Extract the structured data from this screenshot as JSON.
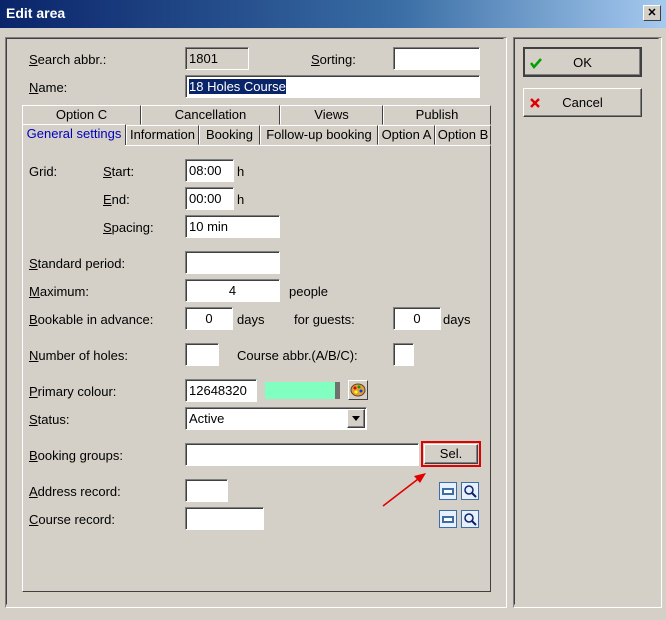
{
  "window": {
    "title": "Edit area"
  },
  "form": {
    "search_abbr_label": "Search abbr.:",
    "search_abbr_value": "1801",
    "sorting_label": "Sorting:",
    "sorting_value": "",
    "name_label": "Name:",
    "name_value": "18 Holes Course"
  },
  "tabs_row1": [
    "Option C",
    "Cancellation",
    "Views",
    "Publish"
  ],
  "tabs_row2": [
    "General settings",
    "Information",
    "Booking",
    "Follow-up booking",
    "Option A",
    "Option B"
  ],
  "general": {
    "grid_label": "Grid:",
    "start_label": "Start:",
    "start_value": "08:00",
    "start_unit": "h",
    "end_label": "End:",
    "end_value": "00:00",
    "end_unit": "h",
    "spacing_label": "Spacing:",
    "spacing_value": "10 min",
    "standard_period_label": "Standard period:",
    "standard_period_value": "",
    "maximum_label": "Maximum:",
    "maximum_value": "4",
    "maximum_unit": "people",
    "bookable_label": "Bookable in advance:",
    "bookable_value": "0",
    "bookable_unit": "days",
    "guests_label": "for guests:",
    "guests_value": "0",
    "guests_unit": "days",
    "holes_label": "Number of holes:",
    "holes_value": "",
    "course_abbr_label": "Course abbr.(A/B/C):",
    "course_abbr_value": "",
    "primary_colour_label": "Primary colour:",
    "primary_colour_value": "12648320",
    "status_label": "Status:",
    "status_value": "Active",
    "booking_groups_label": "Booking groups:",
    "booking_groups_value": "",
    "sel_button": "Sel.",
    "address_record_label": "Address record:",
    "address_record_value": "",
    "course_record_label": "Course record:",
    "course_record_value": ""
  },
  "buttons": {
    "ok": "OK",
    "cancel": "Cancel"
  },
  "colors": {
    "title_bar": "#0a246a",
    "primary_colour_swatch": "#80ffc0",
    "highlight": "#e00000"
  }
}
